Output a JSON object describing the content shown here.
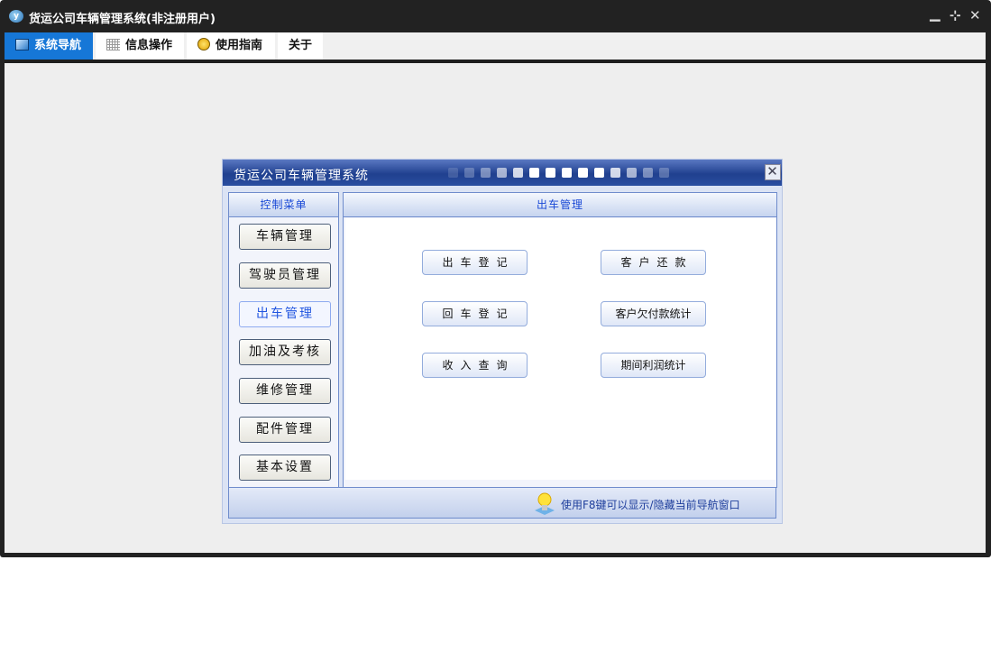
{
  "window": {
    "title": "货运公司车辆管理系统(非注册用户)",
    "icon_text": "y"
  },
  "tabs": [
    {
      "label": "系统导航",
      "icon": "monitor-icon"
    },
    {
      "label": "信息操作",
      "icon": "grid-icon"
    },
    {
      "label": "使用指南",
      "icon": "help-icon"
    },
    {
      "label": "关于"
    }
  ],
  "dialog": {
    "title": "货运公司车辆管理系统",
    "left_header": "控制菜单",
    "right_header": "出车管理",
    "menu": [
      "车辆管理",
      "驾驶员管理",
      "出车管理",
      "加油及考核",
      "维修管理",
      "配件管理",
      "基本设置"
    ],
    "selected_menu": "出车管理",
    "actions": [
      "出车登记",
      "客户还款",
      "回车登记",
      "客户欠付款统计",
      "收入查询",
      "期间利润统计"
    ],
    "footer": "使用F8键可以显示/隐藏当前导航窗口"
  },
  "colors": {
    "accent": "#1677d7",
    "dialog_title": "#20408f"
  }
}
